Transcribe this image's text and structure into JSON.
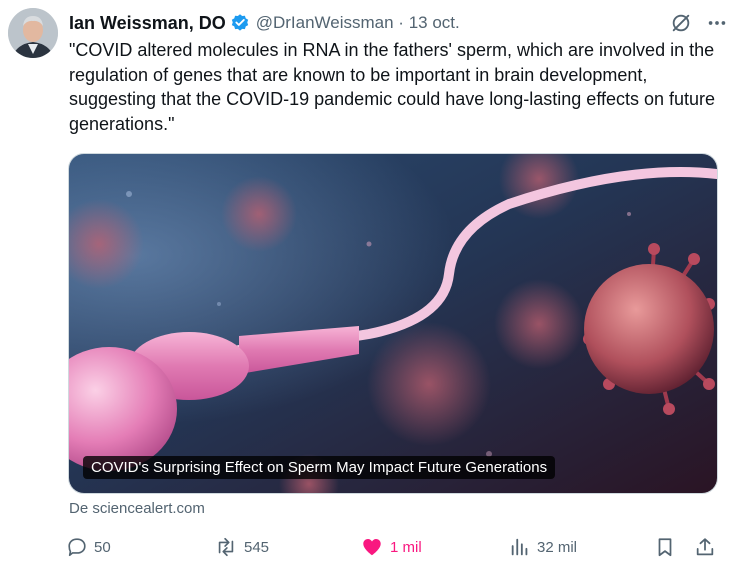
{
  "tweet": {
    "author_name": "Ian Weissman, DO",
    "handle_line": "@DrIanWeissman · 13 oct.",
    "text": "\"COVID altered molecules in RNA in the fathers' sperm, which are involved in the regulation of genes that are known to be important in brain development, suggesting that the COVID-19 pandemic could have long-lasting effects on future generations.\"",
    "card": {
      "title": "COVID's Surprising Effect on Sperm May Impact Future Generations"
    },
    "source": "De sciencealert.com"
  },
  "actions": {
    "replies": "50",
    "reposts": "545",
    "likes": "1 mil",
    "views": "32 mil"
  },
  "colors": {
    "verified": "#1d9bf0",
    "like": "#f91880",
    "secondary_text": "#536471"
  },
  "icons": [
    "verified-badge-icon",
    "grok-icon",
    "more-icon",
    "reply-icon",
    "repost-icon",
    "heart-icon",
    "views-icon",
    "bookmark-icon",
    "share-icon"
  ]
}
